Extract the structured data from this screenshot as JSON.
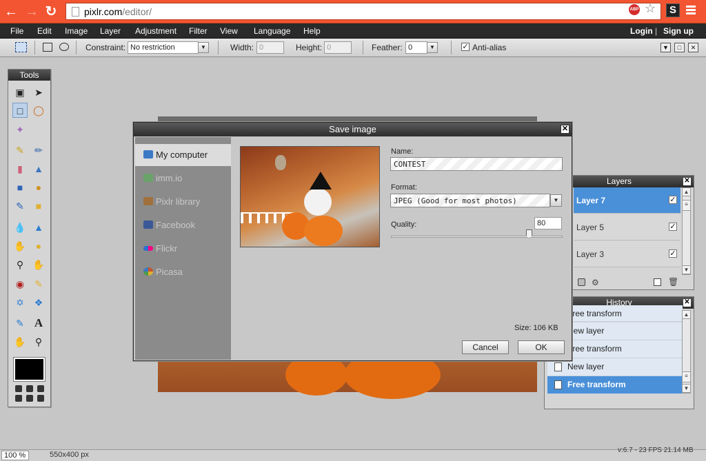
{
  "browser": {
    "url_host": "pixlr.com",
    "url_path": "/editor/",
    "abp_label": "ABP",
    "ext_label": "S"
  },
  "menubar": {
    "items": [
      "File",
      "Edit",
      "Image",
      "Layer",
      "Adjustment",
      "Filter",
      "View",
      "Language",
      "Help"
    ],
    "login": "Login",
    "separator": "|",
    "signup": "Sign up"
  },
  "options": {
    "constraint_label": "Constraint:",
    "constraint_value": "No restriction",
    "width_label": "Width:",
    "width_value": "0",
    "height_label": "Height:",
    "height_value": "0",
    "feather_label": "Feather:",
    "feather_value": "0",
    "antialias_label": "Anti-alias",
    "antialias_checked": true
  },
  "tools": {
    "title": "Tools",
    "icons": [
      "crop-icon",
      "move-icon",
      "marquee-icon",
      "lasso-icon",
      "wand-icon",
      "pencil-icon",
      "brush-icon",
      "eraser-icon",
      "bucket-icon",
      "gradient-icon",
      "stamp-icon",
      "replace-icon",
      "shape-icon",
      "blur-icon",
      "sharpen-icon",
      "smudge-icon",
      "sponge-icon",
      "dodge-icon",
      "burn-icon",
      "redeye-icon",
      "spot-heal-icon",
      "bloat-icon",
      "pinch-icon",
      "picker-icon",
      "text-icon",
      "hand-icon",
      "zoom-icon"
    ]
  },
  "layers": {
    "title": "Layers",
    "items": [
      {
        "name": "Layer 7",
        "selected": true
      },
      {
        "name": "Layer 5",
        "selected": false
      },
      {
        "name": "Layer 3",
        "selected": false
      }
    ]
  },
  "history": {
    "title": "History",
    "items": [
      {
        "name": "Free transform",
        "selected": false
      },
      {
        "name": "New layer",
        "selected": false
      },
      {
        "name": "Free transform",
        "selected": false
      },
      {
        "name": "New layer",
        "selected": false
      },
      {
        "name": "Free transform",
        "selected": true
      }
    ]
  },
  "dialog": {
    "title": "Save image",
    "sources": [
      {
        "label": "My computer",
        "selected": true,
        "color": "#3b79c4"
      },
      {
        "label": "imm.io",
        "selected": false,
        "color": "#6aa36a"
      },
      {
        "label": "Pixlr library",
        "selected": false,
        "color": "#a0703c"
      },
      {
        "label": "Facebook",
        "selected": false,
        "color": "#3b5998"
      },
      {
        "label": "Flickr",
        "selected": false,
        "color": "#ff0084"
      },
      {
        "label": "Picasa",
        "selected": false,
        "color": "#c9542f"
      }
    ],
    "name_label": "Name:",
    "name_value": "CONTEST",
    "format_label": "Format:",
    "format_value": "JPEG (Good for most photos)",
    "quality_label": "Quality:",
    "quality_value": "80",
    "size_text": "Size: 106 KB",
    "cancel": "Cancel",
    "ok": "OK"
  },
  "status": {
    "zoom": "100 %",
    "dims": "550x400 px",
    "version": "v:6.7 - 23 FPS 21.14 MB"
  }
}
